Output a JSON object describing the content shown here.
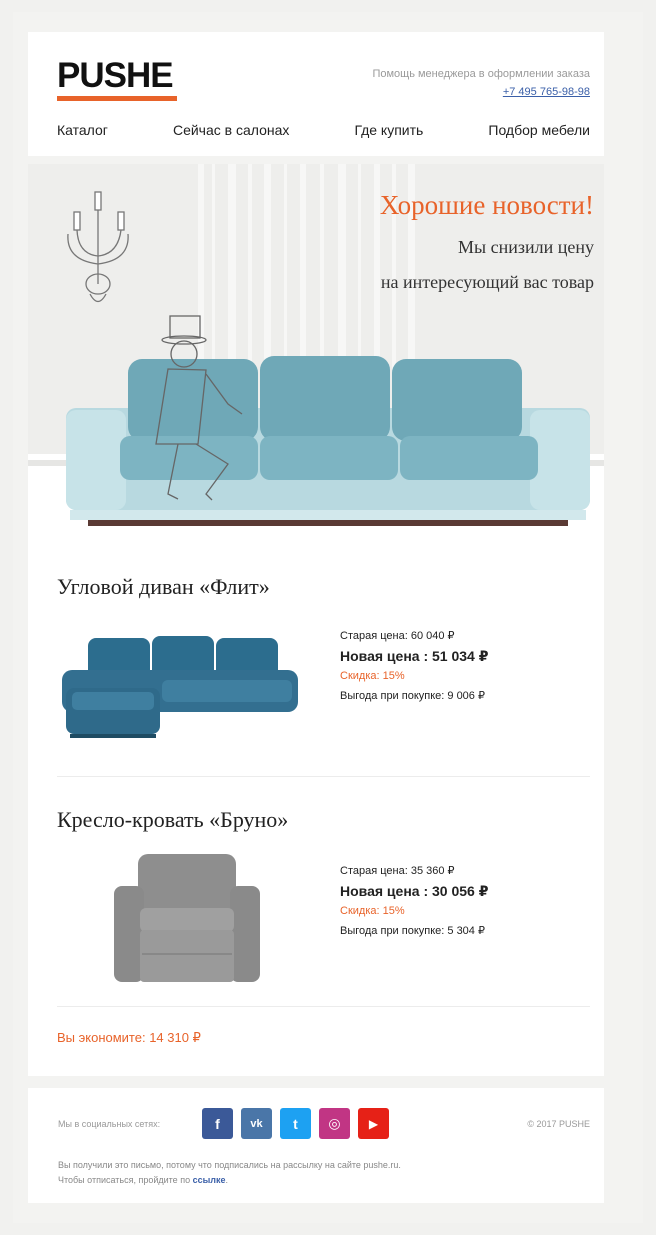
{
  "brand": {
    "logo_text": "PUSHE",
    "accent_color": "#e8632a"
  },
  "header": {
    "help_text": "Помощь менеджера в оформлении заказа",
    "phone": "+7 495 765-98-98",
    "nav": [
      {
        "label": "Каталог"
      },
      {
        "label": "Сейчас в салонах"
      },
      {
        "label": "Где купить"
      },
      {
        "label": "Подбор мебели"
      }
    ]
  },
  "hero": {
    "title": "Хорошие новости!",
    "subtitle_line1": "Мы снизили цену",
    "subtitle_line2": "на интересующий вас товар"
  },
  "products": [
    {
      "title": "Угловой диван «Флит»",
      "old_price": "Старая цена: 60 040 ₽",
      "new_price": "Новая цена : 51 034 ₽",
      "discount": "Скидка: 15%",
      "benefit": "Выгода при покупке: 9 006 ₽",
      "image_icon": "corner-sofa-image"
    },
    {
      "title": "Кресло-кровать «Бруно»",
      "old_price": "Старая цена: 35 360 ₽",
      "new_price": "Новая цена : 30 056 ₽",
      "discount": "Скидка: 15%",
      "benefit": "Выгода при покупке: 5 304 ₽",
      "image_icon": "armchair-bed-image"
    }
  ],
  "savings": "Вы экономите: 14 310 ₽",
  "footer": {
    "social_label": "Мы в социальных сетях:",
    "social": [
      {
        "name": "facebook-icon",
        "glyph": "f",
        "color": "#3b5998"
      },
      {
        "name": "vk-icon",
        "glyph": "vk",
        "color": "#4a76a8"
      },
      {
        "name": "twitter-icon",
        "glyph": "t",
        "color": "#1da1f2"
      },
      {
        "name": "instagram-icon",
        "glyph": "◎",
        "color": "#c13584"
      },
      {
        "name": "youtube-icon",
        "glyph": "▶",
        "color": "#e62117"
      }
    ],
    "copyright": "© 2017 PUSHE",
    "note_line1": "Вы получили это письмо, потому что подписались на рассылку на сайте pushe.ru.",
    "note_line2_prefix": "Чтобы отписаться, пройдите по",
    "note_link": "ссылке"
  }
}
